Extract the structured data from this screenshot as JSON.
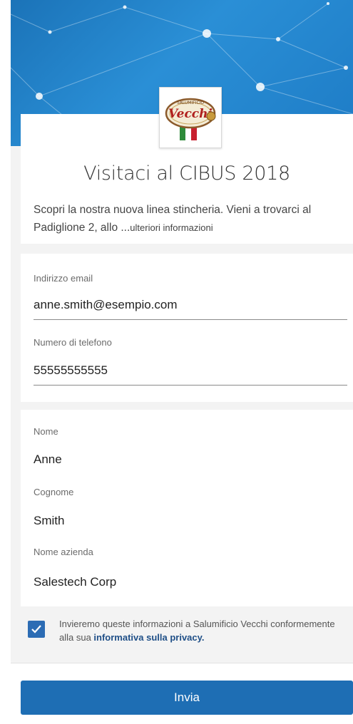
{
  "brand": {
    "logo_text": "Vecchi",
    "logo_top_text": "SALUMIFICIO"
  },
  "form": {
    "title": "Visitaci al CIBUS 2018",
    "description": "Scopri la nostra nuova linea stincheria. Vieni a trovarci al Padiglione 2, allo ...",
    "more_info": "ulteriori informazioni",
    "fields": {
      "email_label": "Indirizzo email",
      "email_value": "anne.smith@esempio.com",
      "phone_label": "Numero di telefono",
      "phone_value": "55555555555",
      "first_name_label": "Nome",
      "first_name_value": "Anne",
      "last_name_label": "Cognome",
      "last_name_value": "Smith",
      "company_label": "Nome azienda",
      "company_value": "Salestech Corp"
    },
    "consent": {
      "checked": true,
      "text": "Invieremo queste informazioni a Salumificio Vecchi conformemente alla sua ",
      "link": "informativa sulla privacy."
    },
    "submit_label": "Invia"
  },
  "colors": {
    "header_blue": "#2a8fd6",
    "button_blue": "#1e6eb4",
    "checkbox_blue": "#2c6cb4",
    "link_blue": "#1f4f87"
  },
  "icons": {
    "checkbox": "checkmark-icon",
    "logo": "salumificio-vecchi-logo"
  }
}
